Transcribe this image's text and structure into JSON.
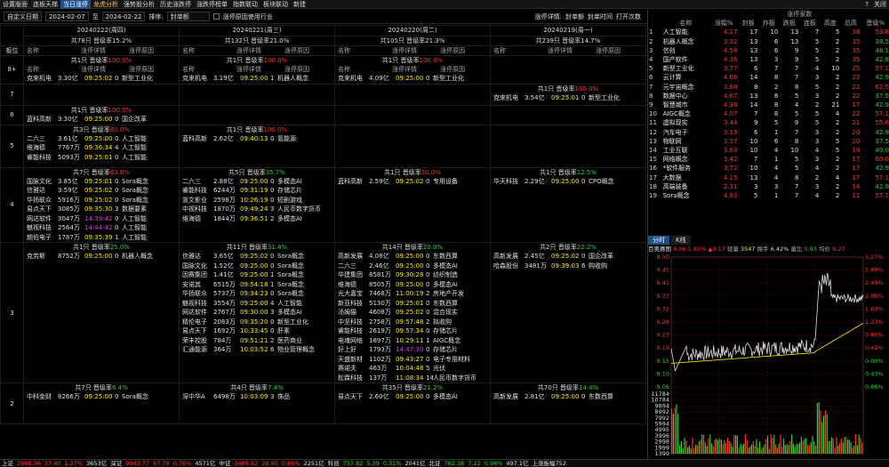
{
  "menu": {
    "items": [
      "设置版面",
      "连板天梯",
      "当日涨停",
      "龙虎分析",
      "强势股分析",
      "历史涨跌停",
      "涨跌停榜单",
      "指数联动",
      "板块联动",
      "新建"
    ],
    "active_index": 2,
    "highlight_index": 3,
    "help": "?",
    "close": "关闭"
  },
  "filter": {
    "label": "自定义日期",
    "date_from": "2024-02-07",
    "to": "至",
    "date_to": "2024-02-22",
    "sort_label": "排序:",
    "sort_value": "封单额",
    "reason_label": "涨停原因使用行业",
    "detail_label": "涨停详情:",
    "detail_items": [
      "封单额",
      "封单时间",
      "打开次数"
    ]
  },
  "board": {
    "days": [
      {
        "date": "20240222(周四)",
        "summary": "共78只 晋级率15.2%"
      },
      {
        "date": "20240221(周三)",
        "summary": "共132只 晋级率21.0%"
      },
      {
        "date": "20240220(周二)",
        "summary": "共105只 晋级率21.3%"
      },
      {
        "date": "20240219(周一)",
        "summary": "共239只 晋级率14.7%"
      }
    ],
    "label_header": "板位",
    "col_headers": [
      "名称",
      "涨停详情",
      "涨停原因"
    ],
    "levels": [
      {
        "label": "8+",
        "cells": [
          {
            "sum": "共1只 晋级率",
            "rate": "100.0%",
            "green": false,
            "hdr": true,
            "rows": [
              [
                "克来机电",
                "3.30亿",
                "09:25:02",
                "0",
                "新型工业化"
              ]
            ]
          },
          {
            "sum": "共1只 晋级率",
            "rate": "100.0%",
            "green": false,
            "hdr": true,
            "rows": [
              [
                "克来机电",
                "3.19亿",
                "09:25:00",
                "1",
                "机器人概念"
              ]
            ]
          },
          {
            "sum": "共1只 晋级率",
            "rate": "100.0%",
            "green": false,
            "hdr": true,
            "rows": [
              [
                "克来机电",
                "4.09亿",
                "09:25:00",
                "0",
                "新型工业化"
              ]
            ]
          },
          null
        ]
      },
      {
        "label": "7",
        "cells": [
          null,
          null,
          null,
          {
            "sum": "共1只 晋级率",
            "rate": "100.0%",
            "green": false,
            "hdr": false,
            "rows": [
              [
                "克来机电",
                "3.54亿",
                "09:25:01",
                "0",
                "新型工业化"
              ]
            ]
          }
        ]
      },
      {
        "label": "6",
        "cells": [
          {
            "sum": "共1只 晋级率",
            "rate": "100.0%",
            "green": false,
            "hdr": false,
            "rows": [
              [
                "蓝科高新",
                "3.30亿",
                "09:25:00",
                "0",
                "国企改革"
              ]
            ]
          },
          null,
          null,
          null
        ]
      },
      {
        "label": "5",
        "cells": [
          {
            "sum": "共3只 晋级率",
            "rate": "60.0%",
            "green": false,
            "hdr": false,
            "rows": [
              [
                "二六三",
                "3.61亿",
                "09:25:00",
                "0",
                "人工智能"
              ],
              [
                "维海德",
                "7767万",
                "09:36:34",
                "4",
                "人工智能"
              ],
              [
                "睿能科技",
                "5093万",
                "09:25:01",
                "0",
                "人工智能"
              ]
            ]
          },
          {
            "sum": "共1只 晋级率",
            "rate": "100.0%",
            "green": false,
            "hdr": false,
            "rows": [
              [
                "蓝科高新",
                "2.62亿",
                "09:40:13",
                "0",
                "氢能源"
              ]
            ]
          },
          null,
          null
        ]
      },
      {
        "label": "4",
        "cells": [
          {
            "sum": "共7只 晋级率",
            "rate": "63.6%",
            "green": false,
            "hdr": false,
            "rows": [
              [
                "国脉文化",
                "3.85亿",
                "09:25:01",
                "0",
                "Sora概念"
              ],
              [
                "信雅达",
                "3.59亿",
                "09:25:02",
                "0",
                "Sora概念"
              ],
              [
                "华扬联众",
                "5916万",
                "09:25:02",
                "0",
                "Sora概念"
              ],
              [
                "易点天下",
                "3085万",
                "09:35:30",
                "3",
                "数据要素"
              ],
              [
                "网达软件",
                "3047万",
                "14:39:42",
                "0",
                "人工智能"
              ],
              [
                "魅视科技",
                "2564万",
                "14:44:42",
                "0",
                "人工智能"
              ],
              [
                "朗伯电子",
                "1787万",
                "09:35:39",
                "1",
                "人工智能"
              ]
            ]
          },
          {
            "sum": "共5只 晋级率",
            "rate": "35.7%",
            "green": true,
            "hdr": false,
            "rows": [
              [
                "二六三",
                "2.88亿",
                "09:25:00",
                "0",
                "多模态AI"
              ],
              [
                "睿能科技",
                "6244万",
                "09:31:19",
                "0",
                "存储芯片"
              ],
              [
                "浙文影业",
                "2598万",
                "10:26:19",
                "0",
                "短剧游戏"
              ],
              [
                "中视科技",
                "1870万",
                "09:49:24",
                "3",
                "人民币数字货币"
              ],
              [
                "维海德",
                "1844万",
                "09:36:51",
                "2",
                "多模态AI"
              ]
            ]
          },
          {
            "sum": "共1只 晋级率",
            "rate": "50.0%",
            "green": false,
            "hdr": false,
            "rows": [
              [
                "蓝科高新",
                "2.59亿",
                "09:25:02",
                "0",
                "专用设备"
              ]
            ]
          },
          {
            "sum": "共1只 晋级率",
            "rate": "12.5%",
            "green": true,
            "hdr": false,
            "rows": [
              [
                "华天科技",
                "2.29亿",
                "09:25:00",
                "0",
                "CPO概念"
              ]
            ]
          }
        ]
      },
      {
        "label": "3",
        "cells": [
          {
            "sum": "共1只 晋级率",
            "rate": "25.0%",
            "green": true,
            "hdr": false,
            "rows": [
              [
                "克劳斯",
                "8752万",
                "09:25:00",
                "0",
                "机器人概念"
              ]
            ]
          },
          {
            "sum": "共11只 晋级率",
            "rate": "31.4%",
            "green": true,
            "hdr": false,
            "rows": [
              [
                "信雅达",
                "3.65亿",
                "09:25:02",
                "0",
                "Sora概念"
              ],
              [
                "国脉文化",
                "1.52亿",
                "09:25:00",
                "0",
                "Sora概念"
              ],
              [
                "因赛集团",
                "1.41亿",
                "09:25:00",
                "1",
                "Sora概念"
              ],
              [
                "安诺其",
                "6515万",
                "09:54:18",
                "1",
                "Sora概念"
              ],
              [
                "华扬联众",
                "5737万",
                "09:34:23",
                "0",
                "Sora概念"
              ],
              [
                "魅视科技",
                "3554万",
                "09:25:00",
                "4",
                "人工智能"
              ],
              [
                "网达软件",
                "2767万",
                "09:30:00",
                "3",
                "多模态AI"
              ],
              [
                "精伦电子",
                "2083万",
                "09:35:20",
                "0",
                "新型工业化"
              ],
              [
                "易点天下",
                "1692万",
                "10:33:45",
                "0",
                "肝素"
              ],
              [
                "荣丰控股",
                "784万",
                "09:51:21",
                "2",
                "医药商业"
              ],
              [
                "汇通能源",
                "364万",
                "10:03:52",
                "6",
                "物业管理概念"
              ]
            ]
          },
          {
            "sum": "共14只 晋级率",
            "rate": "20.0%",
            "green": true,
            "hdr": false,
            "rows": [
              [
                "高新发展",
                "4.08亿",
                "09:25:00",
                "0",
                "东数西算"
              ],
              [
                "二六三",
                "2.46亿",
                "09:25:00",
                "0",
                "多模态AI"
              ],
              [
                "华建集团",
                "8581万",
                "09:30:28",
                "0",
                "纺织制造"
              ],
              [
                "维海德",
                "8505万",
                "09:25:00",
                "0",
                "多模态AI"
              ],
              [
                "光大嘉宝",
                "7468万",
                "11:00:19",
                "2",
                "房地产开发"
              ],
              [
                "新亚科技",
                "5130万",
                "09:25:01",
                "0",
                "东数西算"
              ],
              [
                "汤姆猫",
                "4608万",
                "09:25:02",
                "0",
                "混合现实"
              ],
              [
                "中坚科技",
                "2758万",
                "09:57:48",
                "2",
                "拟收购"
              ],
              [
                "睿能科技",
                "2619万",
                "09:57:34",
                "0",
                "存储芯片"
              ],
              [
                "电魂网络",
                "1897万",
                "10:29:11",
                "1",
                "AIGC概念"
              ],
              [
                "好上好",
                "1793万",
                "14:47:30",
                "0",
                "存储芯片"
              ],
              [
                "天盛新材",
                "1102万",
                "09:43:27",
                "0",
                "电子专用材料"
              ],
              [
                "赛诺夫",
                "463万",
                "10:04:48",
                "5",
                "光伏"
              ],
              [
                "松霖科技",
                "137万",
                "11:08:34",
                "14",
                "人民币数字货币"
              ]
            ]
          },
          {
            "sum": "共2只 晋级率",
            "rate": "22.2%",
            "green": true,
            "hdr": false,
            "rows": [
              [
                "高新发展",
                "2.45亿",
                "09:25:02",
                "0",
                "国企改革"
              ],
              [
                "哈森股份",
                "3481万",
                "09:39:03",
                "6",
                "购收购"
              ]
            ]
          }
        ]
      },
      {
        "label": "2",
        "cells": [
          {
            "sum": "共7只 晋级率",
            "rate": "6.4%",
            "green": true,
            "hdr": false,
            "rows": [
              [
                "中科金财",
                "8266万",
                "09:25:00",
                "0",
                "Sora概念"
              ]
            ]
          },
          {
            "sum": "共4只 晋级率",
            "rate": "7.4%",
            "green": true,
            "hdr": false,
            "rows": [
              [
                "深中华A",
                "6498万",
                "10:03:09",
                "3",
                "饰品"
              ]
            ]
          },
          {
            "sum": "共35只 晋级率",
            "rate": "21.2%",
            "green": true,
            "hdr": false,
            "rows": [
              [
                "易点天下",
                "2.60亿",
                "09:25:00",
                "0",
                "多模态AI"
              ]
            ]
          },
          {
            "sum": "共70只 晋级率",
            "rate": "14.4%",
            "green": true,
            "hdr": false,
            "rows": [
              [
                "高新发展",
                "2.81亿",
                "09:25:00",
                "0",
                "东数西算"
              ]
            ]
          }
        ]
      }
    ]
  },
  "sectors": {
    "headers": [
      "名称",
      "涨幅%",
      "封板",
      "炸板",
      "跌板",
      "连板",
      "高度",
      "总高",
      "晋级%"
    ],
    "group_header": "涨停家数",
    "rows": [
      [
        "1",
        "人工智能",
        "4.17",
        "17",
        "10",
        "13",
        "7",
        "5",
        "36",
        "53.8"
      ],
      [
        "2",
        "机器人概念",
        "3.32",
        "13",
        "6",
        "13",
        "5",
        "2",
        "35",
        "38.5"
      ],
      [
        "3",
        "信创",
        "4.58",
        "13",
        "6",
        "9",
        "5",
        "2",
        "35",
        "48.1"
      ],
      [
        "4",
        "国产软件",
        "4.36",
        "13",
        "3",
        "9",
        "5",
        "2",
        "35",
        "42.8"
      ],
      [
        "5",
        "新型工业化",
        "3.77",
        "6",
        "7",
        "7",
        "4",
        "10",
        "25",
        "57.1"
      ],
      [
        "6",
        "云计算",
        "4.66",
        "14",
        "8",
        "7",
        "3",
        "2",
        "22",
        "42.9"
      ],
      [
        "7",
        "元宇宙概念",
        "3.68",
        "8",
        "2",
        "8",
        "5",
        "2",
        "22",
        "62.5"
      ],
      [
        "8",
        "数据中心",
        "4.67",
        "13",
        "8",
        "5",
        "3",
        "2",
        "22",
        "37.5"
      ],
      [
        "9",
        "智慧城市",
        "4.38",
        "14",
        "8",
        "4",
        "2",
        "21",
        "17",
        "42.9"
      ],
      [
        "10",
        "AIGC概念",
        "4.07",
        "7",
        "8",
        "5",
        "5",
        "4",
        "22",
        "57.1"
      ],
      [
        "11",
        "虚拟现实",
        "3.44",
        "9",
        "5",
        "9",
        "5",
        "2",
        "21",
        "55.6"
      ],
      [
        "12",
        "汽车电子",
        "3.13",
        "6",
        "1",
        "7",
        "3",
        "2",
        "20",
        "42.9"
      ],
      [
        "13",
        "物联网",
        "3.57",
        "10",
        "6",
        "8",
        "3",
        "5",
        "20",
        "37.5"
      ],
      [
        "14",
        "工业互联",
        "3.63",
        "10",
        "4",
        "10",
        "4",
        "5",
        "19",
        "40.0"
      ],
      [
        "15",
        "网络概念",
        "3.42",
        "7",
        "1",
        "5",
        "3",
        "2",
        "17",
        "60.0"
      ],
      [
        "16",
        "*软件服务",
        "3.72",
        "10",
        "4",
        "5",
        "4",
        "2",
        "17",
        "42.9"
      ],
      [
        "17",
        "大数据",
        "4.15",
        "13",
        "4",
        "8",
        "2",
        "4",
        "17",
        "57.1"
      ],
      [
        "18",
        "高端装备",
        "2.31",
        "3",
        "3",
        "7",
        "3",
        "2",
        "14",
        "42.9"
      ],
      [
        "19",
        "Sora概念",
        "4.93",
        "5",
        "1",
        "7",
        "4",
        "2",
        "11",
        "57.1"
      ]
    ]
  },
  "quote": {
    "tabs": [
      "分时",
      "K线"
    ],
    "name": "百奥赛图",
    "price": "9.36",
    "pct": "1.85%",
    "chg": "▲0.17",
    "vol_label": "现量",
    "vol": "3547",
    "turn_label": "换手",
    "turn": "6.42%",
    "ratio_label": "量比",
    "ratio": "0.93",
    "avg_label": "均价",
    "avg": "9.27",
    "y_left": [
      "9.50",
      "9.45",
      "9.41",
      "9.37",
      "9.32",
      "9.28",
      "9.23",
      "9.19",
      "9.15",
      "9.10",
      "9.06"
    ],
    "y_right": [
      "3.27%",
      "2.89%",
      "2.49%",
      "2.05%",
      "1.63%",
      "1.23%",
      "0.80%",
      "0.42%",
      "0.00%",
      "0.43%",
      "0.86%"
    ],
    "v_left": [
      "11784",
      "10784",
      "9894",
      "8992",
      "7992",
      "5994",
      "4995",
      "3996",
      "2998",
      "1999",
      "1399"
    ],
    "x": [
      "09:30",
      "10:30",
      "11:30/13:00",
      "14:00",
      "15:00"
    ]
  },
  "statusbar": [
    {
      "t": "上证",
      "c": "w"
    },
    {
      "t": "2988.36",
      "c": "r"
    },
    {
      "t": "37.40",
      "c": "r"
    },
    {
      "t": "1.27%",
      "c": "r"
    },
    {
      "t": "3653亿",
      "c": "w"
    },
    {
      "t": "深证",
      "c": "w"
    },
    {
      "t": "9043.77",
      "c": "r"
    },
    {
      "t": "67.78",
      "c": "r"
    },
    {
      "t": "0.76%",
      "c": "r"
    },
    {
      "t": "4571亿",
      "c": "w"
    },
    {
      "t": "中证",
      "c": "w"
    },
    {
      "t": "3486.62",
      "c": "r"
    },
    {
      "t": "29.80",
      "c": "r"
    },
    {
      "t": "0.86%",
      "c": "r"
    },
    {
      "t": "2251亿",
      "c": "w"
    },
    {
      "t": "科创",
      "c": "w"
    },
    {
      "t": "757.82",
      "c": "g"
    },
    {
      "t": "5.39",
      "c": "g"
    },
    {
      "t": "0.31%",
      "c": "g"
    },
    {
      "t": "2041亿",
      "c": "w"
    },
    {
      "t": "北证",
      "c": "w"
    },
    {
      "t": "762.38",
      "c": "g"
    },
    {
      "t": "7.22",
      "c": "g"
    },
    {
      "t": "0.96%",
      "c": "g"
    },
    {
      "t": "497.1亿",
      "c": "w"
    },
    {
      "t": "上涨板幅752",
      "c": "w"
    }
  ]
}
